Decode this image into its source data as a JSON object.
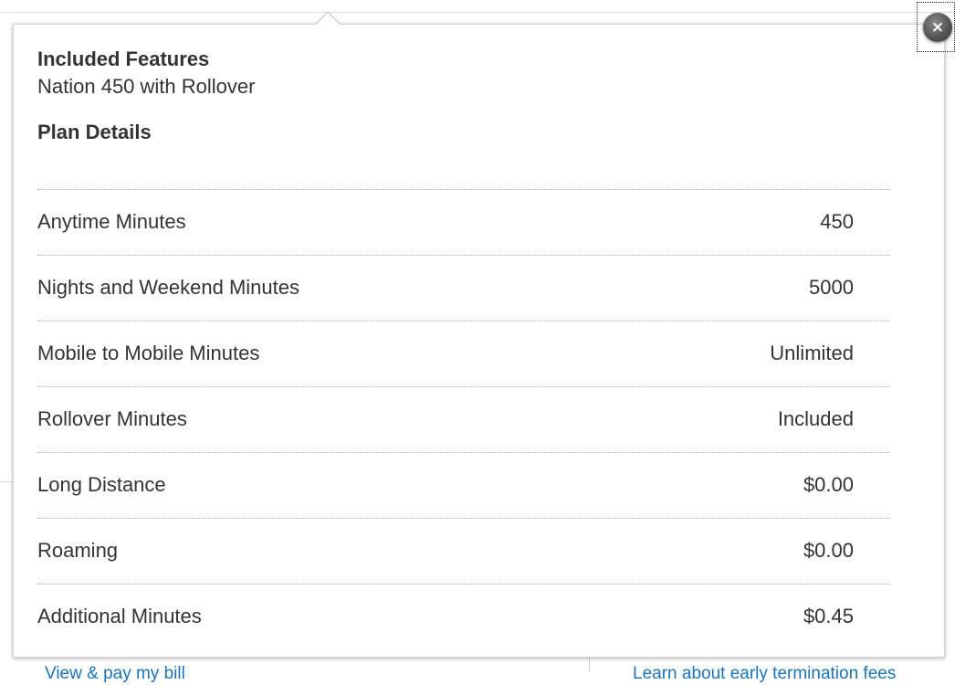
{
  "background": {
    "left_link": "View & pay my bill",
    "right_link": "Learn about early termination fees"
  },
  "popup": {
    "close_symbol": "×",
    "included_features_heading": "Included Features",
    "plan_name": "Nation 450 with Rollover",
    "plan_details_heading": "Plan Details",
    "details": [
      {
        "label": "Anytime Minutes",
        "value": "450"
      },
      {
        "label": "Nights and Weekend Minutes",
        "value": "5000"
      },
      {
        "label": "Mobile to Mobile Minutes",
        "value": "Unlimited"
      },
      {
        "label": "Rollover Minutes",
        "value": "Included"
      },
      {
        "label": "Long Distance",
        "value": "$0.00"
      },
      {
        "label": "Roaming",
        "value": "$0.00"
      },
      {
        "label": "Additional Minutes",
        "value": "$0.45"
      }
    ]
  },
  "colors": {
    "text": "#333333",
    "link": "#1a73b8",
    "close_button": "#555555"
  },
  "icons": {
    "close": "close-icon"
  }
}
